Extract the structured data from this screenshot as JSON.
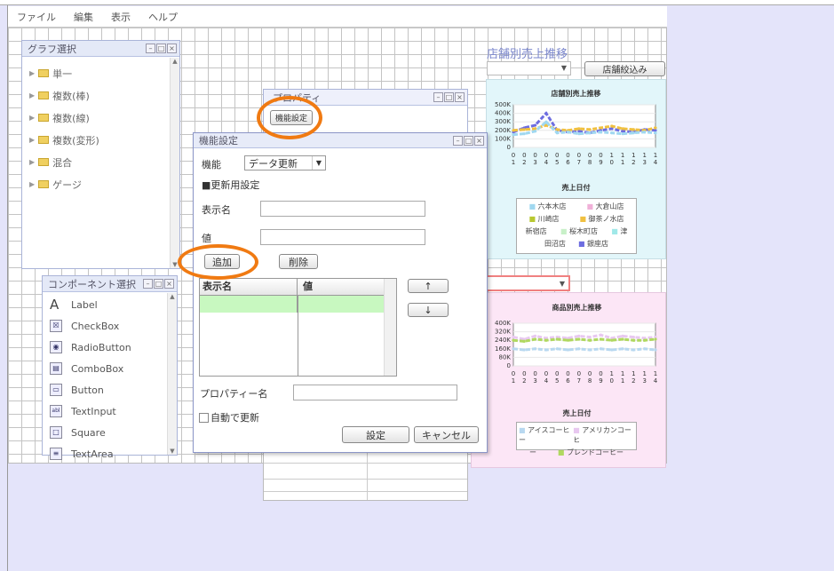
{
  "menu": [
    "ファイル",
    "編集",
    "表示",
    "ヘルプ"
  ],
  "graph_panel": {
    "title": "グラフ選択",
    "items": [
      "単一",
      "複数(棒)",
      "複数(線)",
      "複数(変形)",
      "混合",
      "ゲージ"
    ]
  },
  "component_panel": {
    "title": "コンポーネント選択",
    "items": [
      {
        "icon": "A",
        "label": "Label"
      },
      {
        "icon": "☒",
        "label": "CheckBox"
      },
      {
        "icon": "◉",
        "label": "RadioButton"
      },
      {
        "icon": "▤",
        "label": "ComboBox"
      },
      {
        "icon": "▭",
        "label": "Button"
      },
      {
        "icon": "abl",
        "label": "TextInput"
      },
      {
        "icon": "□",
        "label": "Square"
      },
      {
        "icon": "≡",
        "label": "TextArea"
      }
    ]
  },
  "property_panel": {
    "title": "プロパティ",
    "button": "機能設定"
  },
  "dialog": {
    "title": "機能設定",
    "function_label": "機能",
    "function_value": "データ更新",
    "section": "■更新用設定",
    "display_name_label": "表示名",
    "value_label": "値",
    "add_button": "追加",
    "delete_button": "削除",
    "table_headers": [
      "表示名",
      "値"
    ],
    "up_arrow": "↑",
    "down_arrow": "↓",
    "property_name_label": "プロパティー名",
    "auto_update_label": "自動で更新",
    "ok_button": "設定",
    "cancel_button": "キャンセル"
  },
  "store_area": {
    "title": "店舗別売上推移",
    "filter_button": "店舗絞込み"
  },
  "chart_top": {
    "title": "店舗別売上推移",
    "xlabel": "売上日付",
    "x_ticks": [
      "01",
      "02",
      "03",
      "04",
      "05",
      "06",
      "07",
      "08",
      "09",
      "10",
      "11",
      "12",
      "13",
      "14"
    ],
    "y_ticks": [
      "500K",
      "400K",
      "300K",
      "200K",
      "100K",
      "0"
    ],
    "legend": [
      "六本木店",
      "大倉山店",
      "川崎店",
      "御茶ノ水店",
      "新宿店",
      "桜木町店",
      "津",
      "田沼店",
      "銀座店"
    ]
  },
  "chart_bottom": {
    "title": "商品別売上推移",
    "xlabel": "売上日付",
    "x_ticks": [
      "01",
      "02",
      "03",
      "04",
      "05",
      "06",
      "07",
      "08",
      "09",
      "10",
      "11",
      "12",
      "13",
      "14"
    ],
    "y_ticks": [
      "400K",
      "320K",
      "240K",
      "160K",
      "80K",
      "0"
    ],
    "legend": [
      "アイスコーヒー",
      "アメリカンコーヒ",
      "ー",
      "ブレンドコーヒー"
    ]
  },
  "chart_data": [
    {
      "type": "line",
      "title": "店舗別売上推移",
      "xlabel": "売上日付",
      "ylim": [
        0,
        500000
      ],
      "categories": [
        "01",
        "02",
        "03",
        "04",
        "05",
        "06",
        "07",
        "08",
        "09",
        "10",
        "11",
        "12",
        "13",
        "14"
      ],
      "series": [
        {
          "name": "銀座店",
          "color": "#6d6de0",
          "values": [
            180000,
            230000,
            260000,
            400000,
            200000,
            180000,
            190000,
            170000,
            200000,
            220000,
            190000,
            180000,
            210000,
            200000
          ]
        },
        {
          "name": "御茶ノ水店",
          "color": "#f0c040",
          "values": [
            200000,
            210000,
            220000,
            260000,
            210000,
            200000,
            220000,
            210000,
            230000,
            250000,
            220000,
            210000,
            200000,
            230000
          ]
        },
        {
          "name": "六本木店",
          "color": "#a0d8f0",
          "values": [
            150000,
            160000,
            190000,
            300000,
            170000,
            180000,
            160000,
            170000,
            180000,
            170000,
            160000,
            170000,
            180000,
            170000
          ]
        }
      ]
    },
    {
      "type": "line",
      "title": "商品別売上推移",
      "xlabel": "売上日付",
      "ylim": [
        0,
        400000
      ],
      "categories": [
        "01",
        "02",
        "03",
        "04",
        "05",
        "06",
        "07",
        "08",
        "09",
        "10",
        "11",
        "12",
        "13",
        "14"
      ],
      "series": [
        {
          "name": "アメリカンコーヒー",
          "color": "#e8c8f0",
          "values": [
            270000,
            250000,
            280000,
            260000,
            270000,
            260000,
            280000,
            270000,
            290000,
            260000,
            280000,
            270000,
            260000,
            270000
          ]
        },
        {
          "name": "ブレンドコーヒー",
          "color": "#b0d860",
          "values": [
            240000,
            230000,
            250000,
            240000,
            250000,
            240000,
            250000,
            240000,
            250000,
            240000,
            250000,
            240000,
            240000,
            250000
          ]
        },
        {
          "name": "アイスコーヒー",
          "color": "#b8d8f0",
          "values": [
            160000,
            150000,
            160000,
            150000,
            160000,
            150000,
            160000,
            150000,
            160000,
            150000,
            160000,
            150000,
            160000,
            150000
          ]
        }
      ]
    }
  ]
}
